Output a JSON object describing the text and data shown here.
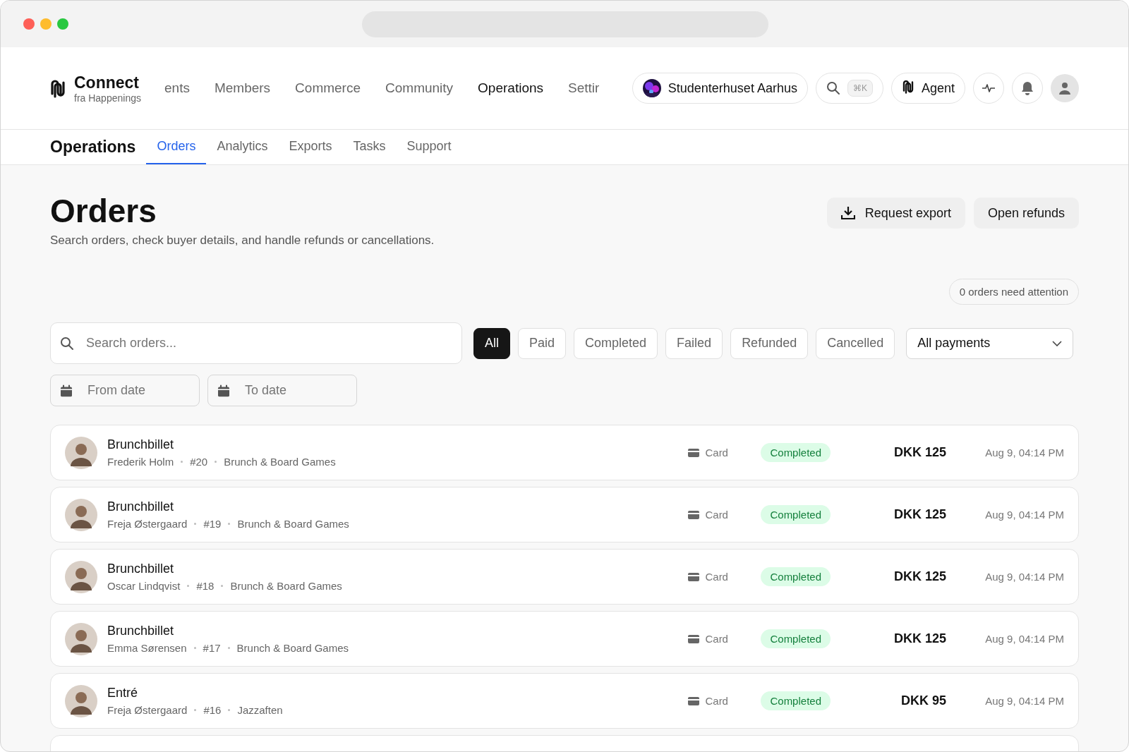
{
  "brand": {
    "name": "Connect",
    "tagline": "fra Happenings"
  },
  "nav": [
    {
      "label": "ents",
      "selected": false
    },
    {
      "label": "Members",
      "selected": false
    },
    {
      "label": "Commerce",
      "selected": false
    },
    {
      "label": "Community",
      "selected": false
    },
    {
      "label": "Operations",
      "selected": true
    },
    {
      "label": "Settir",
      "selected": false
    }
  ],
  "workspace": {
    "name": "Studenterhuset Aarhus"
  },
  "search_shortcut": "⌘K",
  "agent": {
    "label": "Agent"
  },
  "section": {
    "title": "Operations"
  },
  "tabs": [
    {
      "label": "Orders",
      "selected": true
    },
    {
      "label": "Analytics",
      "selected": false
    },
    {
      "label": "Exports",
      "selected": false
    },
    {
      "label": "Tasks",
      "selected": false
    },
    {
      "label": "Support",
      "selected": false
    }
  ],
  "page": {
    "title": "Orders",
    "subtitle": "Search orders, check buyer details, and handle refunds or cancellations."
  },
  "actions": [
    {
      "label": "Request export",
      "kind": "download"
    },
    {
      "label": "Open refunds",
      "kind": "plain"
    }
  ],
  "attention": "0 orders need attention",
  "search": {
    "placeholder": "Search orders..."
  },
  "filters": [
    {
      "label": "All",
      "selected": true
    },
    {
      "label": "Paid",
      "selected": false
    },
    {
      "label": "Completed",
      "selected": false
    },
    {
      "label": "Failed",
      "selected": false
    },
    {
      "label": "Refunded",
      "selected": false
    },
    {
      "label": "Cancelled",
      "selected": false
    }
  ],
  "payment_filter": {
    "value": "All payments"
  },
  "date_fields": [
    {
      "placeholder": "From date"
    },
    {
      "placeholder": "To date"
    }
  ],
  "orders": [
    {
      "title": "Brunchbillet",
      "buyer": "Frederik Holm",
      "number": "#20",
      "event": "Brunch & Board Games",
      "payment": "Card",
      "status": "Completed",
      "color": "#15803d",
      "amount": "DKK 125",
      "date": "Aug 9, 04:14 PM"
    },
    {
      "title": "Brunchbillet",
      "buyer": "Freja Østergaard",
      "number": "#19",
      "event": "Brunch & Board Games",
      "payment": "Card",
      "status": "Completed",
      "color": "#15803d",
      "amount": "DKK 125",
      "date": "Aug 9, 04:14 PM"
    },
    {
      "title": "Brunchbillet",
      "buyer": "Oscar Lindqvist",
      "number": "#18",
      "event": "Brunch & Board Games",
      "payment": "Card",
      "status": "Completed",
      "color": "#15803d",
      "amount": "DKK 125",
      "date": "Aug 9, 04:14 PM"
    },
    {
      "title": "Brunchbillet",
      "buyer": "Emma Sørensen",
      "number": "#17",
      "event": "Brunch & Board Games",
      "payment": "Card",
      "status": "Completed",
      "color": "#15803d",
      "amount": "DKK 125",
      "date": "Aug 9, 04:14 PM"
    },
    {
      "title": "Entré",
      "buyer": "Freja Østergaard",
      "number": "#16",
      "event": "Jazzaften",
      "payment": "Card",
      "status": "Completed",
      "color": "#15803d",
      "amount": "DKK 95",
      "date": "Aug 9, 04:14 PM"
    }
  ]
}
